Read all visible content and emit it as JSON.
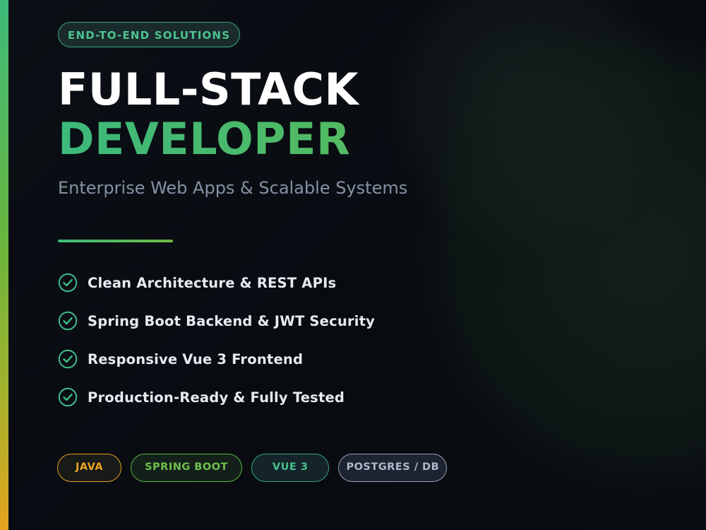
{
  "badge": "END-TO-END SOLUTIONS",
  "title_line1": "FULL-STACK",
  "title_line2": "DEVELOPER",
  "subtitle": "Enterprise Web Apps & Scalable Systems",
  "features": [
    {
      "label": "Clean Architecture & REST APIs",
      "icon": "check-circle-icon"
    },
    {
      "label": "Spring Boot Backend & JWT Security",
      "icon": "check-circle-icon"
    },
    {
      "label": "Responsive Vue 3 Frontend",
      "icon": "check-circle-icon"
    },
    {
      "label": "Production-Ready & Fully Tested",
      "icon": "check-circle-icon"
    }
  ],
  "tags": [
    {
      "label": "JAVA",
      "color": "#eaa324"
    },
    {
      "label": "SPRING BOOT",
      "color": "#6fc04a"
    },
    {
      "label": "VUE 3",
      "color": "#49c08c"
    },
    {
      "label": "POSTGRES / DB",
      "color": "#aeb8c8"
    }
  ],
  "colors": {
    "accent_green": "#3dbb7a",
    "accent_lime": "#6bbb45",
    "accent_orange": "#e6a21e",
    "background": "#0a0d12",
    "title_white": "#ffffff",
    "subtitle_gray": "#8592a6"
  }
}
